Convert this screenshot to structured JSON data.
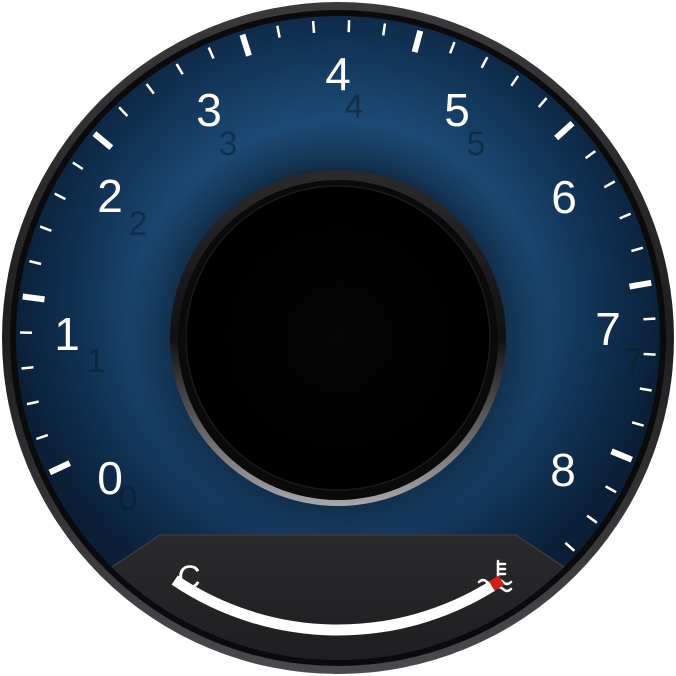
{
  "tachometer": {
    "scale_numerals": [
      "0",
      "1",
      "2",
      "3",
      "4",
      "5",
      "6",
      "7",
      "8"
    ],
    "redline_numeral": "8",
    "redline_color": "#e0231b",
    "dial_color": "#1e4c78"
  },
  "temperature_gauge": {
    "cold_label": "C",
    "icon": "coolant-temperature-icon",
    "level": 1.0,
    "hot_zone_color": "#d21f1a"
  }
}
